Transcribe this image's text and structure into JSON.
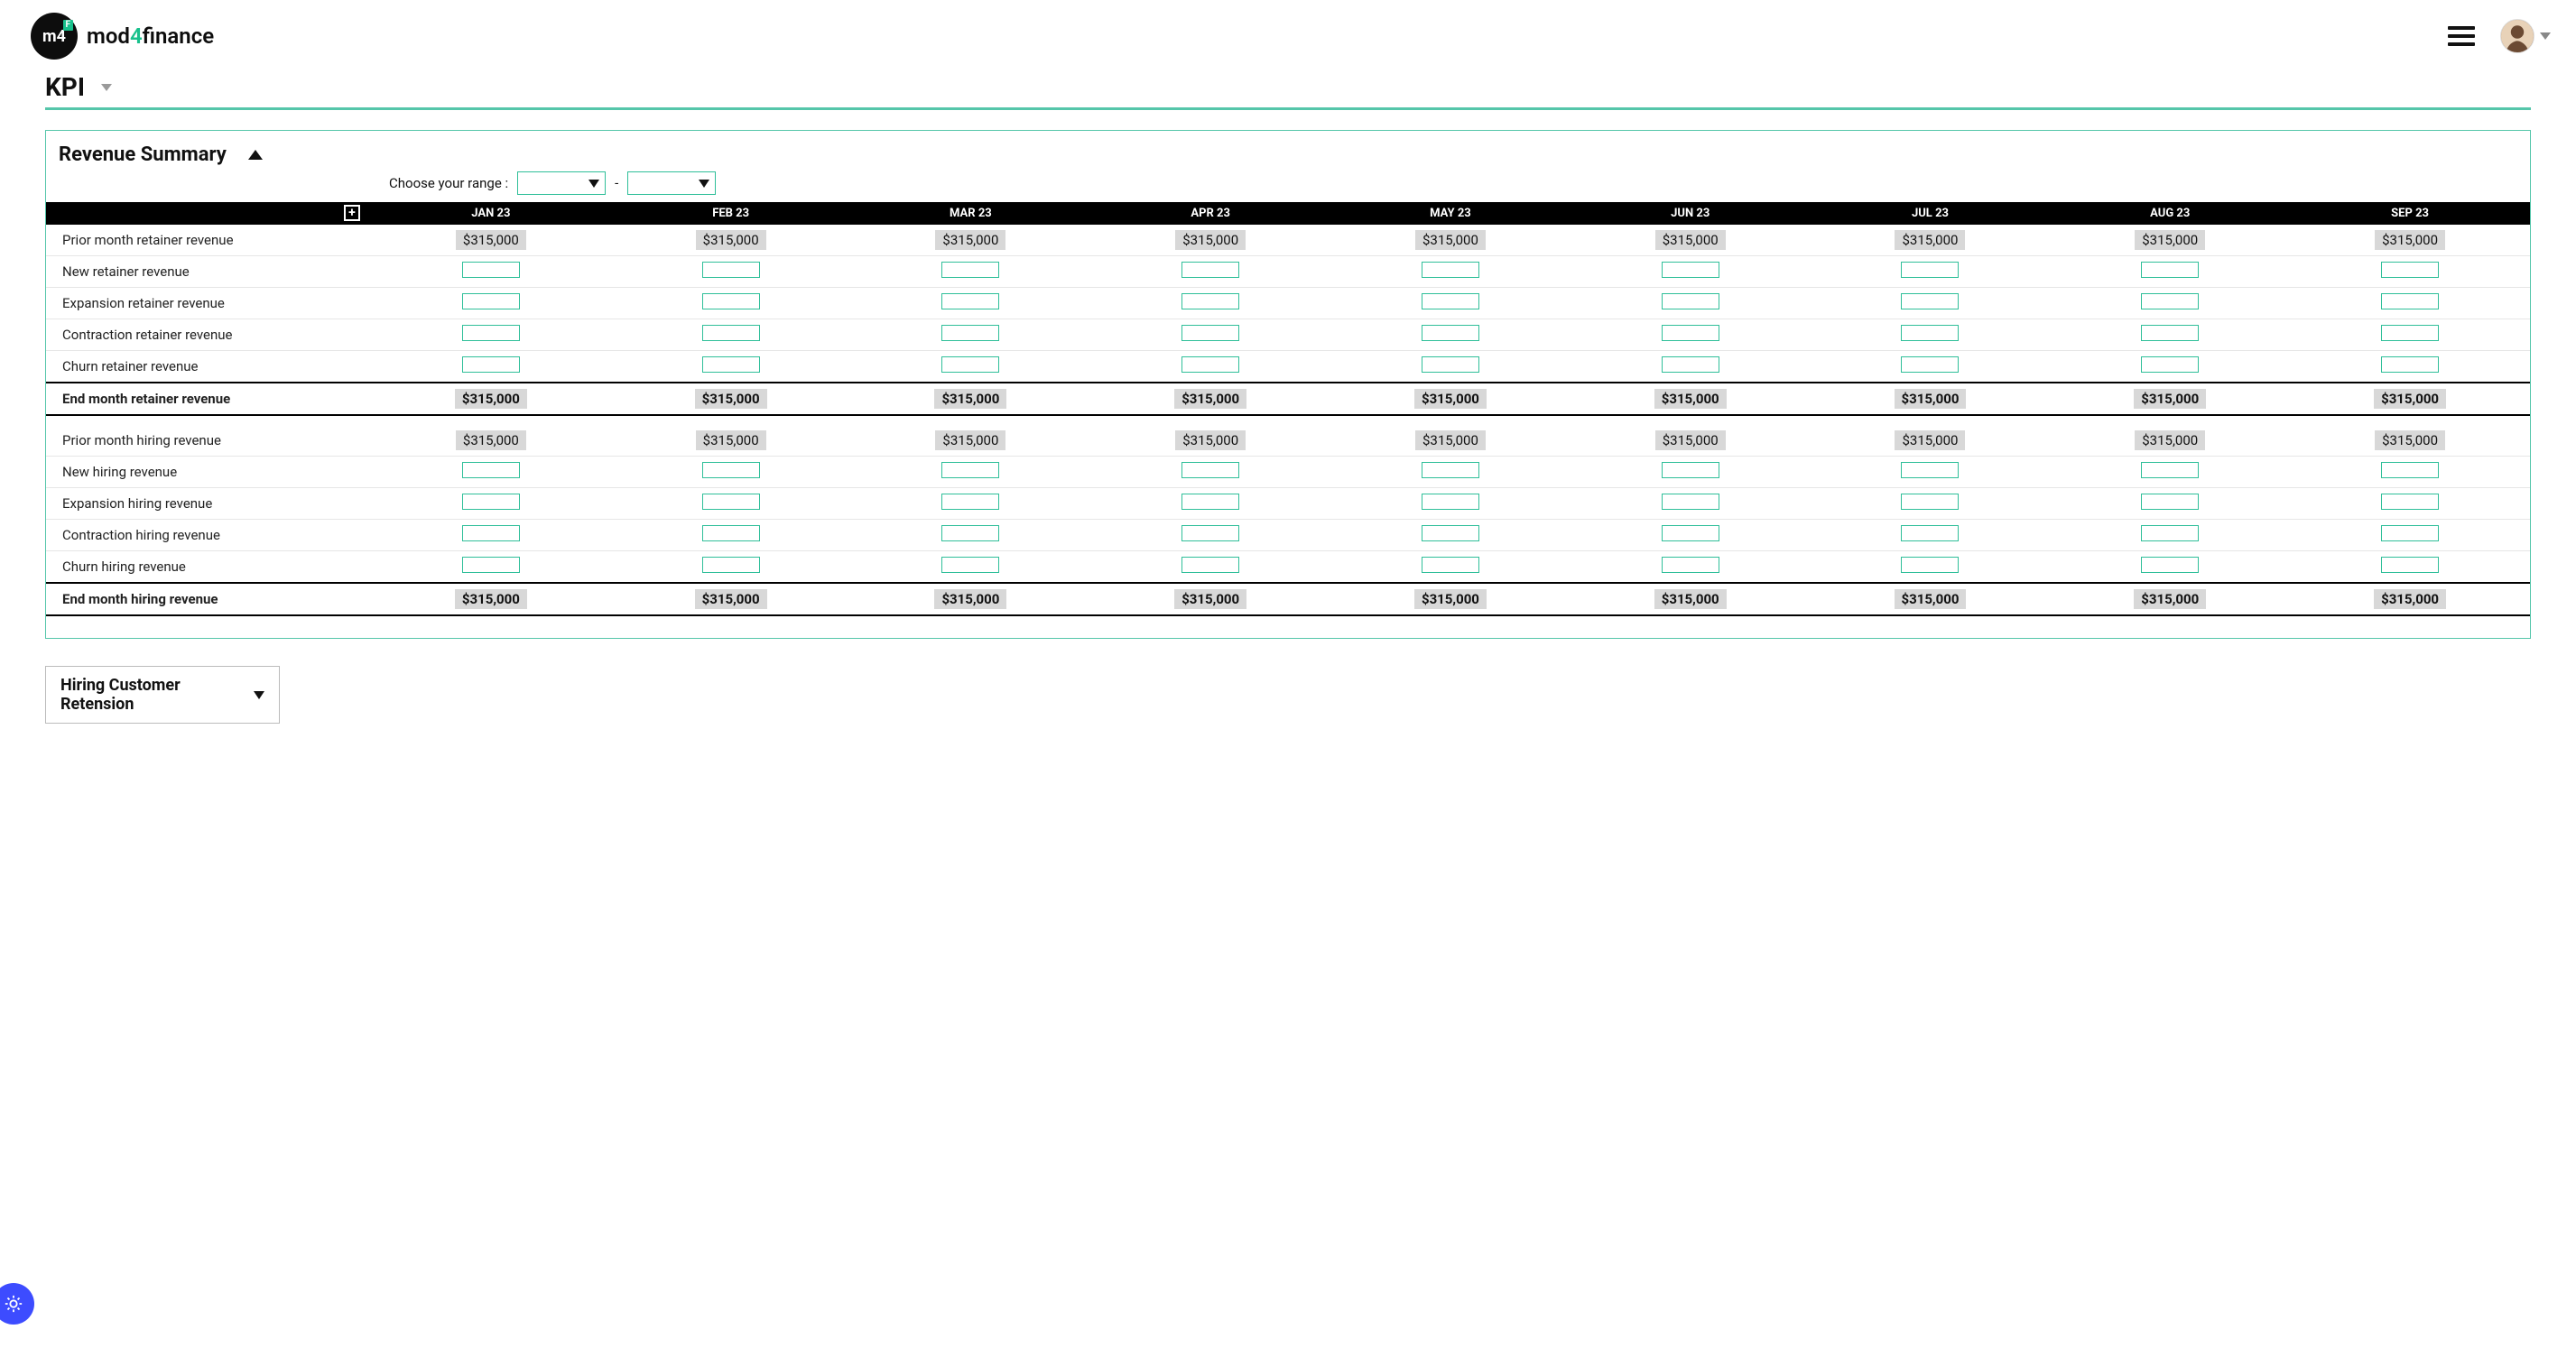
{
  "brand": {
    "name_before": "mod",
    "accent": "4",
    "name_after": "finance"
  },
  "page": {
    "title": "KPI"
  },
  "card": {
    "title": "Revenue Summary",
    "range_label": "Choose your range :"
  },
  "months": [
    "JAN 23",
    "FEB 23",
    "MAR 23",
    "APR 23",
    "MAY 23",
    "JUN 23",
    "JUL 23",
    "AUG 23",
    "SEP 23"
  ],
  "rows": [
    {
      "label": "Prior month retainer revenue",
      "type": "readonly",
      "values": [
        "$315,000",
        "$315,000",
        "$315,000",
        "$315,000",
        "$315,000",
        "$315,000",
        "$315,000",
        "$315,000",
        "$315,000"
      ]
    },
    {
      "label": "New retainer revenue",
      "type": "input"
    },
    {
      "label": "Expansion retainer revenue",
      "type": "input"
    },
    {
      "label": "Contraction retainer revenue",
      "type": "input"
    },
    {
      "label": "Churn retainer revenue",
      "type": "input"
    },
    {
      "label": "End month retainer revenue",
      "type": "total",
      "values": [
        "$315,000",
        "$315,000",
        "$315,000",
        "$315,000",
        "$315,000",
        "$315,000",
        "$315,000",
        "$315,000",
        "$315,000"
      ]
    },
    {
      "label": "Prior month hiring revenue",
      "type": "readonly",
      "values": [
        "$315,000",
        "$315,000",
        "$315,000",
        "$315,000",
        "$315,000",
        "$315,000",
        "$315,000",
        "$315,000",
        "$315,000"
      ]
    },
    {
      "label": "New hiring revenue",
      "type": "input"
    },
    {
      "label": "Expansion hiring revenue",
      "type": "input"
    },
    {
      "label": "Contraction hiring revenue",
      "type": "input"
    },
    {
      "label": "Churn hiring revenue",
      "type": "input"
    },
    {
      "label": "End month hiring revenue",
      "type": "total",
      "values": [
        "$315,000",
        "$315,000",
        "$315,000",
        "$315,000",
        "$315,000",
        "$315,000",
        "$315,000",
        "$315,000",
        "$315,000"
      ]
    }
  ],
  "next_card": {
    "title": "Hiring Customer Retension"
  }
}
